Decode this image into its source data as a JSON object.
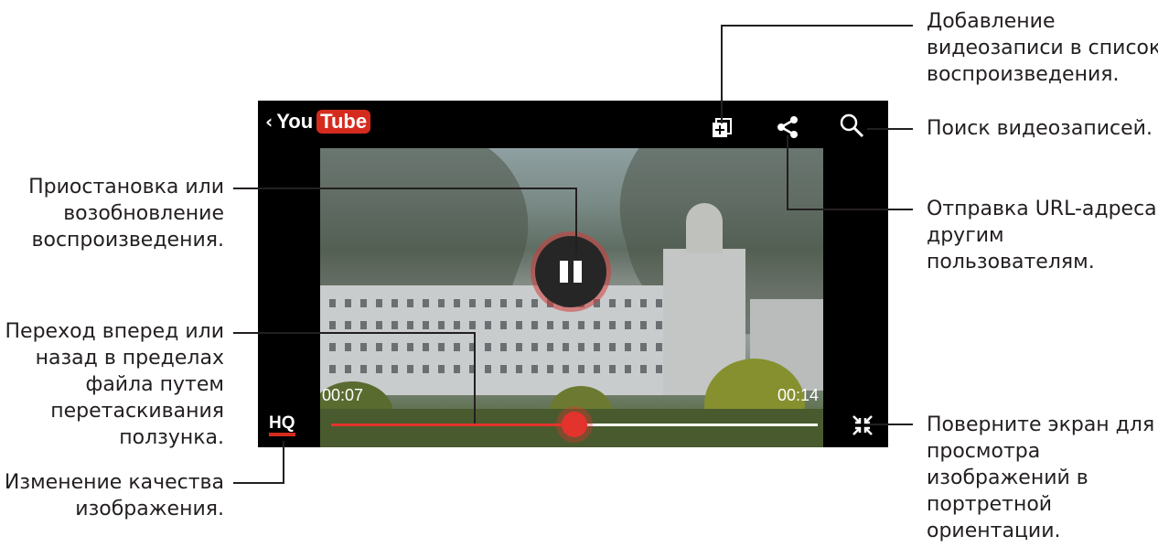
{
  "callouts": {
    "add_to_playlist": [
      "Добавление",
      "видеозаписи в список",
      "воспроизведения."
    ],
    "search": [
      "Поиск видеозаписей."
    ],
    "share_url": [
      "Отправка URL-адреса",
      "другим",
      "пользователям."
    ],
    "rotate": [
      "Поверните экран для",
      "просмотра",
      "изображений в",
      "портретной",
      "ориентации."
    ],
    "pause_resume": [
      "Приостановка или",
      "возобновление",
      "воспроизведения."
    ],
    "seek": [
      "Переход вперед или",
      "назад в пределах",
      "файла путем",
      "перетаскивания",
      "ползунка."
    ],
    "quality": [
      "Изменение качества",
      "изображения."
    ]
  },
  "player": {
    "logo_you": "You",
    "logo_tube": "Tube",
    "current_time": "00:07",
    "total_time": "00:14",
    "hq_label": "HQ",
    "progress_fraction": 0.5
  },
  "icons": {
    "back": "chevron-left-icon",
    "add_playlist": "add-to-playlist-icon",
    "share": "share-icon",
    "search": "search-icon",
    "pause": "pause-icon",
    "exit_fullscreen": "exit-fullscreen-icon"
  },
  "colors": {
    "accent": "#e3332d",
    "youtube_red": "#d52b1e",
    "player_bg": "#000000",
    "text": "#231f20"
  }
}
